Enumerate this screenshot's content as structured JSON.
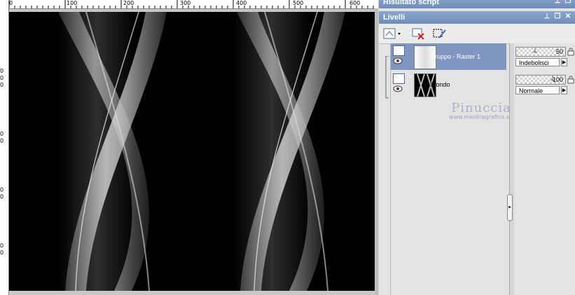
{
  "rulers": {
    "top_labels": [
      "0",
      "100",
      "200",
      "300",
      "400",
      "500",
      "600"
    ],
    "left_labels": [
      "0",
      "0",
      "0",
      "0",
      "0",
      "0",
      "0",
      "0",
      "0"
    ]
  },
  "palettes": {
    "script_title": "Risultato script",
    "layers_title": "Livelli"
  },
  "icons": {
    "new_layer": "new-raster-layer-icon",
    "delete": "delete-layer-icon",
    "mask": "edit-selection-icon",
    "pin": "pin-icon",
    "restore": "restore-icon",
    "close": "close-icon"
  },
  "layers": [
    {
      "name": "Gruppo - Raster 1",
      "opacity": "50",
      "opacity_fraction": 0.5,
      "blend_mode": "Indebolisci",
      "selected": true,
      "thumb": "light"
    },
    {
      "name": "Sfondo",
      "opacity": "100",
      "opacity_fraction": 1.0,
      "blend_mode": "Normale",
      "selected": false,
      "thumb": "dark"
    }
  ],
  "watermark": {
    "name": "Pinuccia",
    "url": "www.maidiregrafica.eu"
  },
  "colors": {
    "title_bar": "#7f97c0",
    "selected_row": "#7f97c0",
    "canvas_bg": "#000000"
  }
}
